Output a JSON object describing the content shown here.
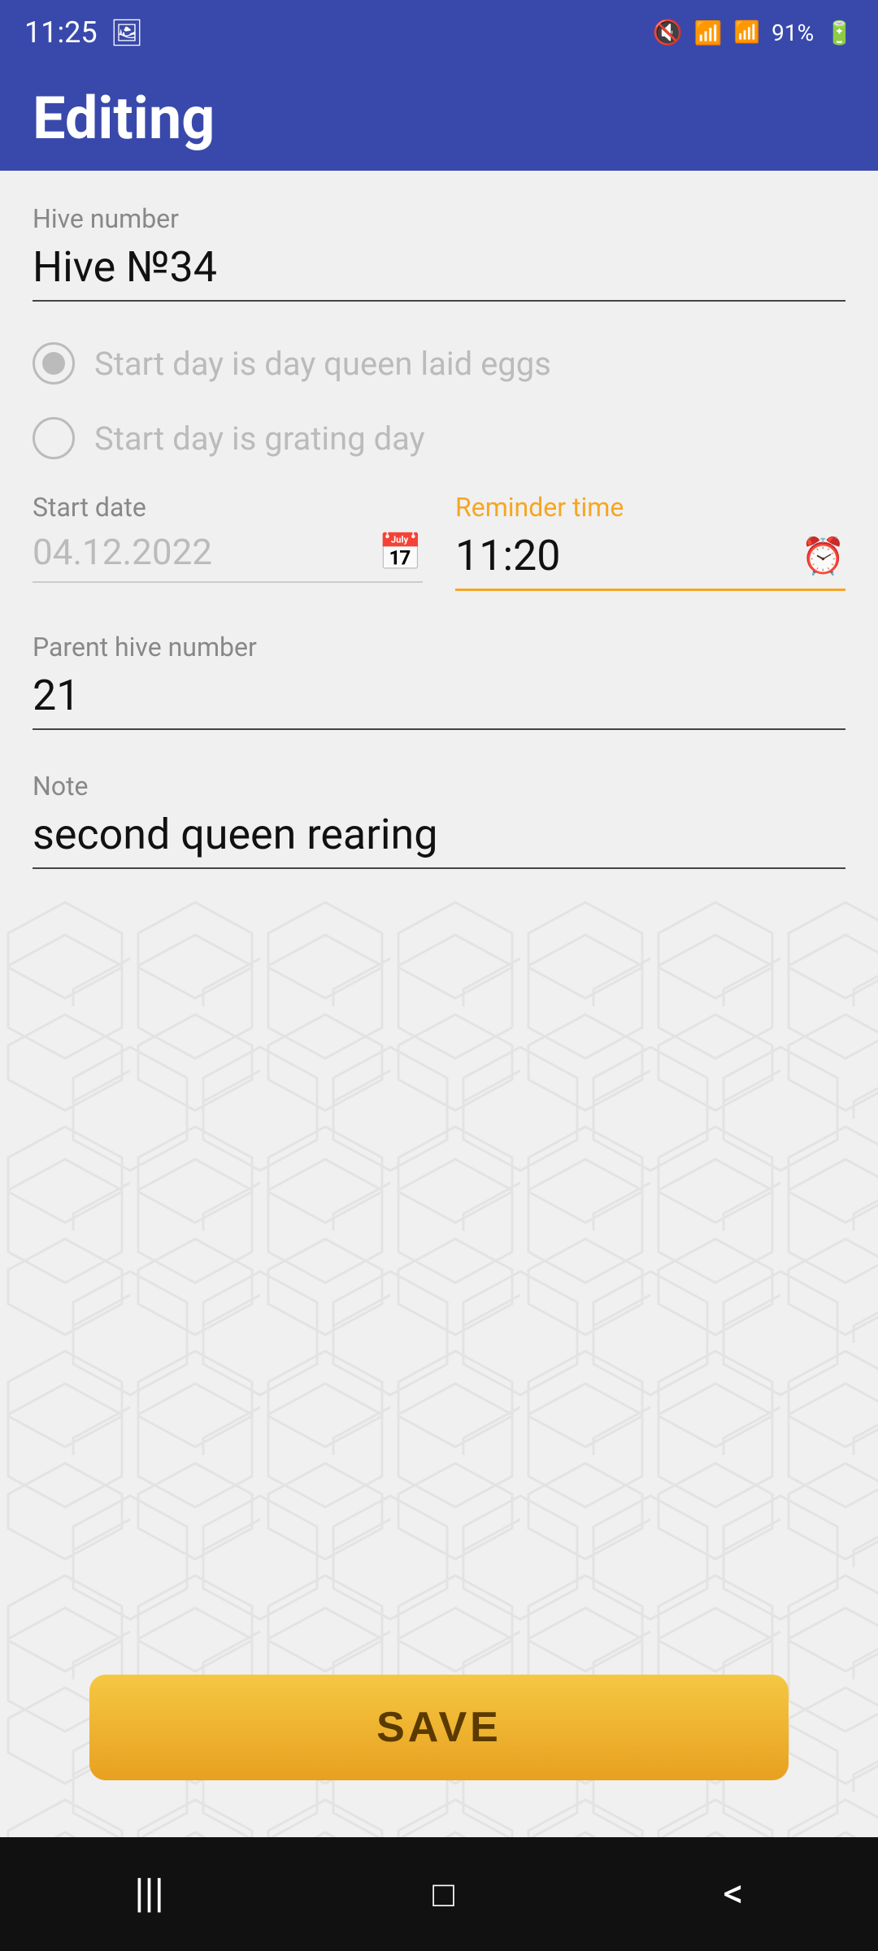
{
  "status": {
    "time": "11:25",
    "battery": "91%"
  },
  "header": {
    "title": "Editing"
  },
  "fields": {
    "hive_number_label": "Hive number",
    "hive_number_value": "Hive №34",
    "radio_option1": "Start day is day queen laid eggs",
    "radio_option2": "Start day is grating day",
    "start_date_label": "Start date",
    "start_date_value": "04.12.2022",
    "reminder_time_label": "Reminder time",
    "reminder_time_value": "11:20",
    "parent_hive_label": "Parent hive number",
    "parent_hive_value": "21",
    "note_label": "Note",
    "note_value": "second queen rearing"
  },
  "buttons": {
    "save": "SAVE"
  },
  "nav": {
    "bars_icon": "|||",
    "square_icon": "□",
    "back_icon": "<"
  }
}
